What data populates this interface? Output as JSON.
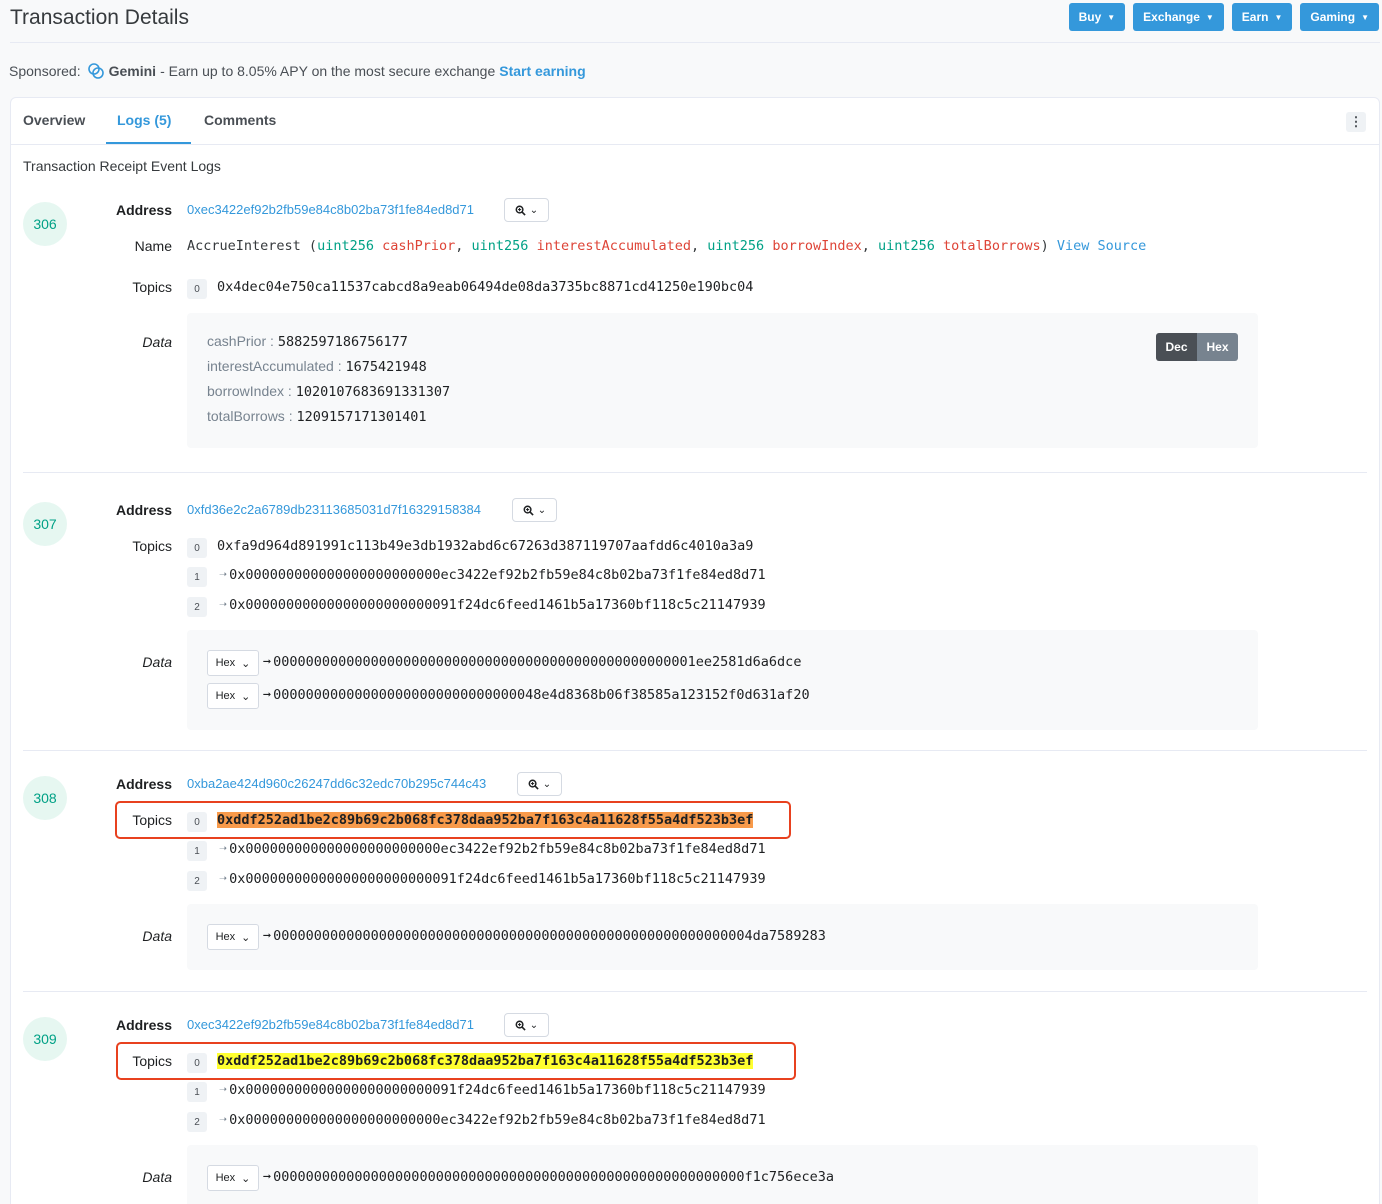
{
  "header": {
    "title": "Transaction Details",
    "buttons": [
      "Buy",
      "Exchange",
      "Earn",
      "Gaming"
    ]
  },
  "sponsored": {
    "prefix": "Sponsored:",
    "brand": "Gemini",
    "text": "- Earn up to 8.05% APY on the most secure exchange",
    "cta": "Start earning"
  },
  "tabs": {
    "overview": "Overview",
    "logs": "Logs (5)",
    "comments": "Comments"
  },
  "subtitle": "Transaction Receipt Event Logs",
  "labels": {
    "address": "Address",
    "name": "Name",
    "topics": "Topics",
    "data": "Data"
  },
  "logs": [
    {
      "index": "306",
      "address": "0xec3422ef92b2fb59e84c8b02ba73f1fe84ed8d71",
      "name": {
        "func": "AccrueInterest",
        "params": [
          {
            "type": "uint256",
            "name": "cashPrior"
          },
          {
            "type": "uint256",
            "name": "interestAccumulated"
          },
          {
            "type": "uint256",
            "name": "borrowIndex"
          },
          {
            "type": "uint256",
            "name": "totalBorrows"
          }
        ],
        "view_source": "View Source"
      },
      "topics": [
        {
          "i": "0",
          "value": "0x4dec04e750ca11537cabcd8a9eab06494de08da3735bc8871cd41250e190bc04"
        }
      ],
      "decoded": [
        {
          "key": "cashPrior :",
          "value": "5882597186756177"
        },
        {
          "key": "interestAccumulated :",
          "value": "1675421948"
        },
        {
          "key": "borrowIndex :",
          "value": "1020107683691331307"
        },
        {
          "key": "totalBorrows :",
          "value": "1209157171301401"
        }
      ],
      "toggle": {
        "dec": "Dec",
        "hex": "Hex"
      }
    },
    {
      "index": "307",
      "address": "0xfd36e2c2a6789db23113685031d7f16329158384",
      "topics": [
        {
          "i": "0",
          "value": "0xfa9d964d891991c113b49e3db1932abd6c67263d387119707aafdd6c4010a3a9"
        },
        {
          "i": "1",
          "value": "0x000000000000000000000000ec3422ef92b2fb59e84c8b02ba73f1fe84ed8d71"
        },
        {
          "i": "2",
          "value": "0x00000000000000000000000091f24dc6feed1461b5a17360bf118c5c21147939"
        }
      ],
      "data": [
        {
          "fmt": "Hex",
          "value": "0000000000000000000000000000000000000000000000000001ee2581d6a6dce"
        },
        {
          "fmt": "Hex",
          "value": "000000000000000000000000000000048e4d8368b06f38585a123152f0d631af20"
        }
      ]
    },
    {
      "index": "308",
      "address": "0xba2ae424d960c26247dd6c32edc70b295c744c43",
      "topics": [
        {
          "i": "0",
          "value": "0xddf252ad1be2c89b69c2b068fc378daa952ba7f163c4a11628f55a4df523b3ef"
        },
        {
          "i": "1",
          "value": "0x000000000000000000000000ec3422ef92b2fb59e84c8b02ba73f1fe84ed8d71"
        },
        {
          "i": "2",
          "value": "0x00000000000000000000000091f24dc6feed1461b5a17360bf118c5c21147939"
        }
      ],
      "data": [
        {
          "fmt": "Hex",
          "value": "00000000000000000000000000000000000000000000000000000000004da7589283"
        }
      ]
    },
    {
      "index": "309",
      "address": "0xec3422ef92b2fb59e84c8b02ba73f1fe84ed8d71",
      "topics": [
        {
          "i": "0",
          "value": "0xddf252ad1be2c89b69c2b068fc378daa952ba7f163c4a11628f55a4df523b3ef"
        },
        {
          "i": "1",
          "value": "0x00000000000000000000000091f24dc6feed1461b5a17360bf118c5c21147939"
        },
        {
          "i": "2",
          "value": "0x000000000000000000000000ec3422ef92b2fb59e84c8b02ba73f1fe84ed8d71"
        }
      ],
      "data": [
        {
          "fmt": "Hex",
          "value": "0000000000000000000000000000000000000000000000000000000000f1c756ece3a"
        }
      ]
    }
  ],
  "colors": {
    "accent": "#3498db",
    "type": "#00a186",
    "param": "#de4437",
    "highlight_orange": "#f89a4a",
    "highlight_yellow": "#ffff30",
    "annotation_box": "#e8411f"
  }
}
